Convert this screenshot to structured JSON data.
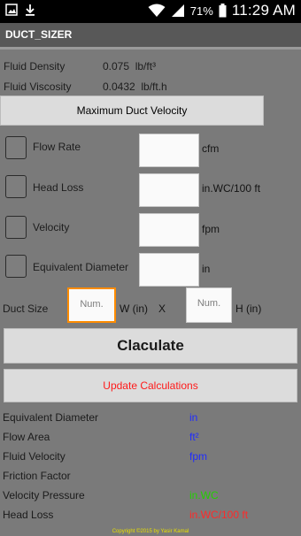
{
  "status": {
    "battery": "71%",
    "time": "11:29 AM"
  },
  "app": {
    "title": "DUCT_SIZER"
  },
  "fluid": {
    "density_label": "Fluid Density",
    "density_value": "0.075",
    "density_unit": "lb/ft³",
    "viscosity_label": "Fluid Viscosity",
    "viscosity_value": "0.0432",
    "viscosity_unit": "lb/ft.h"
  },
  "max_velocity_button": "Maximum Duct Velocity",
  "inputs": [
    {
      "label": "Flow Rate",
      "unit": "cfm"
    },
    {
      "label": "Head Loss",
      "unit": "in.WC/100 ft"
    },
    {
      "label": "Velocity",
      "unit": "fpm"
    },
    {
      "label": "Equivalent Diameter",
      "unit": "in"
    }
  ],
  "duct_size": {
    "label": "Duct Size",
    "w_placeholder": "Num.",
    "w_unit": "W (in)",
    "x": "X",
    "h_placeholder": "Num.",
    "h_unit": "H (in)"
  },
  "calculate_button": "Claculate",
  "update_button": "Update Calculations",
  "results": [
    {
      "label": "Equivalent Diameter",
      "unit": "in",
      "color": "#1f2cff"
    },
    {
      "label": "Flow Area",
      "unit": "ft²",
      "color": "#1f2cff"
    },
    {
      "label": "Fluid Velocity",
      "unit": "fpm",
      "color": "#1f2cff"
    },
    {
      "label": "Friction Factor",
      "unit": "",
      "color": "#1f2cff"
    },
    {
      "label": "Velocity Pressure",
      "unit": "in.WC",
      "color": "#22d000"
    },
    {
      "label": "Head Loss",
      "unit": "in.WC/100 ft",
      "color": "#ff2a2a"
    }
  ],
  "colors": {
    "accent_orange": "#ff8c00",
    "update_red": "#ff1a1a",
    "footer_yellow": "#e8e000"
  },
  "footer": "Copyright ©2015 by Yasir Kamal"
}
